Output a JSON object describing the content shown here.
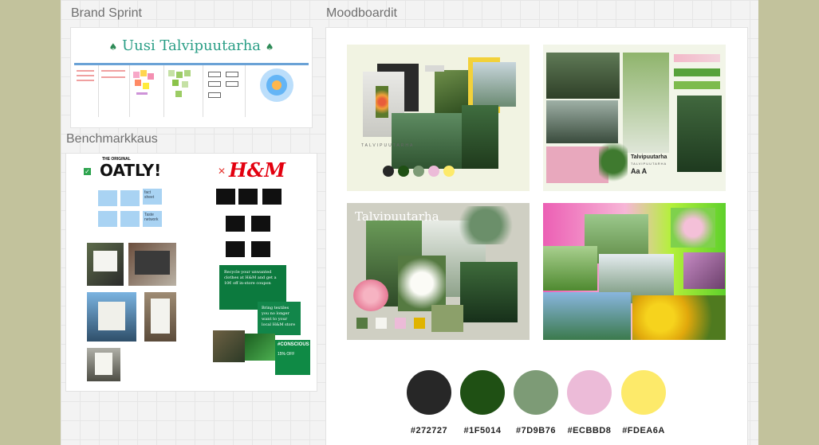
{
  "frames": {
    "brand_sprint": {
      "label": "Brand Sprint",
      "board_title": "Uusi Talvipuutarha"
    },
    "benchmark": {
      "label": "Benchmarkkaus",
      "oatly": "OATLY!",
      "oatly_small": "THE ORIGINAL",
      "hm": "H&M"
    },
    "moodboard": {
      "label": "Moodboardit"
    }
  },
  "stickies": [
    "",
    "",
    "fact sheet",
    "",
    "",
    "Taste network"
  ],
  "moods": {
    "mood1_caption": "TALVIPUUTARHA",
    "mood2_brand": "Talvipuutarha",
    "mood2_sub": "TALVIPUUTARHA",
    "mood2_font": "Aa A",
    "mood3_title": "Talvipuutarha"
  },
  "palette": [
    {
      "hex": "#272727",
      "color": "#272727"
    },
    {
      "hex": "#1F5014",
      "color": "#1F5014"
    },
    {
      "hex": "#7D9B76",
      "color": "#7D9B76"
    },
    {
      "hex": "#ECBBD8",
      "color": "#ECBBD8"
    },
    {
      "hex": "#FDEA6A",
      "color": "#FDEA6A"
    }
  ],
  "ad_texts": {
    "green1": "Recycle your unwanted clothes at H&M and get a 10€ off in-store coupon",
    "green2": "Bring textiles you no longer want to your local H&M store",
    "conscious": "#CONSCIOUS",
    "conscious_sub": "15% OFF"
  }
}
